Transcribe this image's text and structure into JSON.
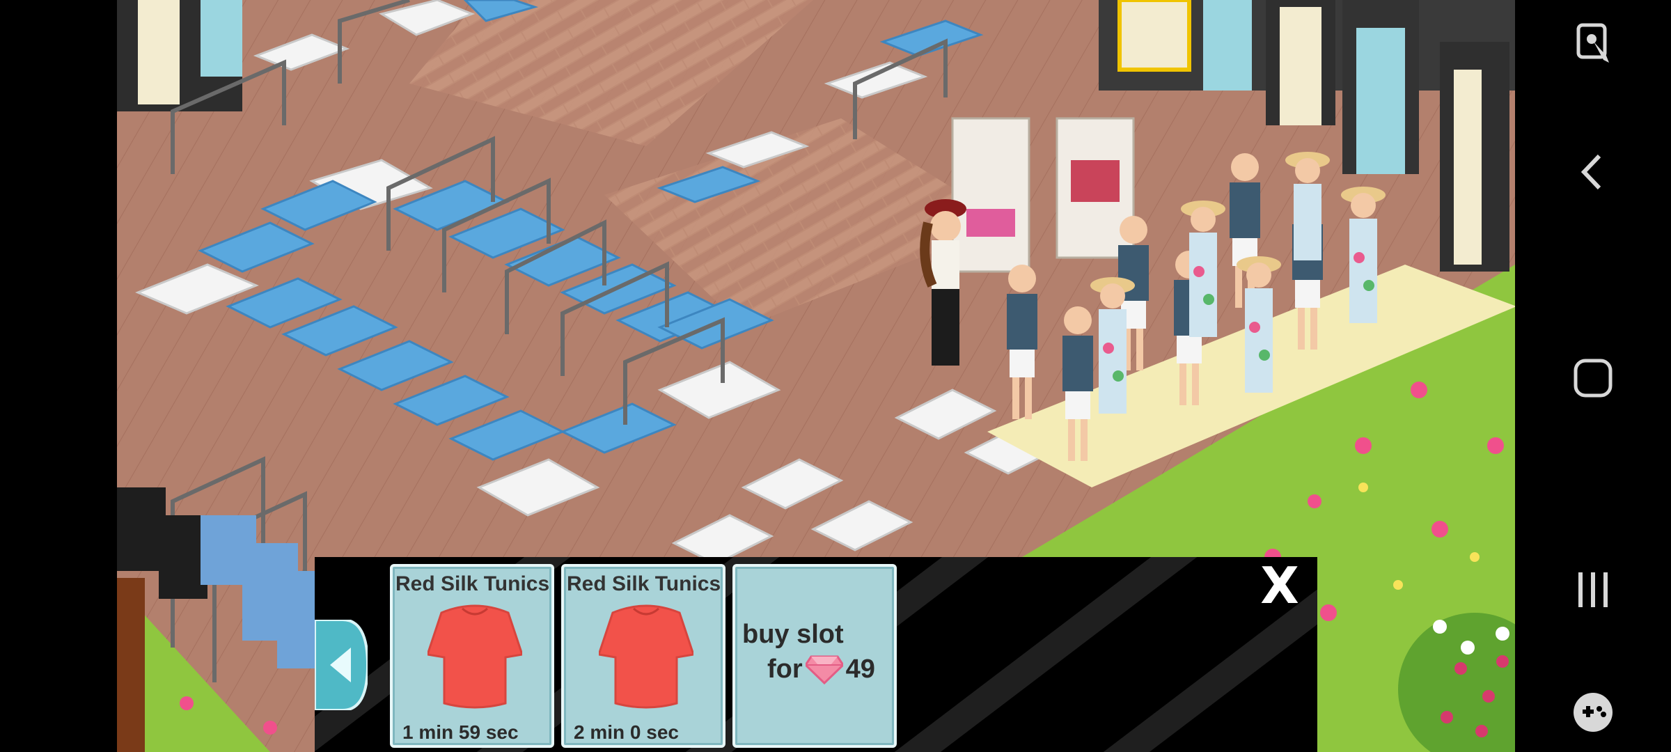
{
  "production_panel": {
    "slots": [
      {
        "title": "Red Silk Tunics",
        "time_left": "1 min 59 sec",
        "icon": "red-tunic-icon"
      },
      {
        "title": "Red Silk Tunics",
        "time_left": "2 min 0 sec",
        "icon": "red-tunic-icon"
      }
    ],
    "buy_slot": {
      "line1": "buy slot",
      "line2_prefix": "for",
      "price": "49",
      "currency_icon": "pink-gem-icon"
    },
    "close_label": "X"
  },
  "nav_bar": {
    "icons": [
      "screenshot-edit-icon",
      "back-icon",
      "home-icon",
      "recents-icon",
      "game-tools-icon"
    ]
  },
  "colors": {
    "slot_bg": "#a9d3d8",
    "tunic": "#f2524a",
    "gem": "#f48ba6",
    "grass": "#8fc63f",
    "floor": "#b98872"
  }
}
